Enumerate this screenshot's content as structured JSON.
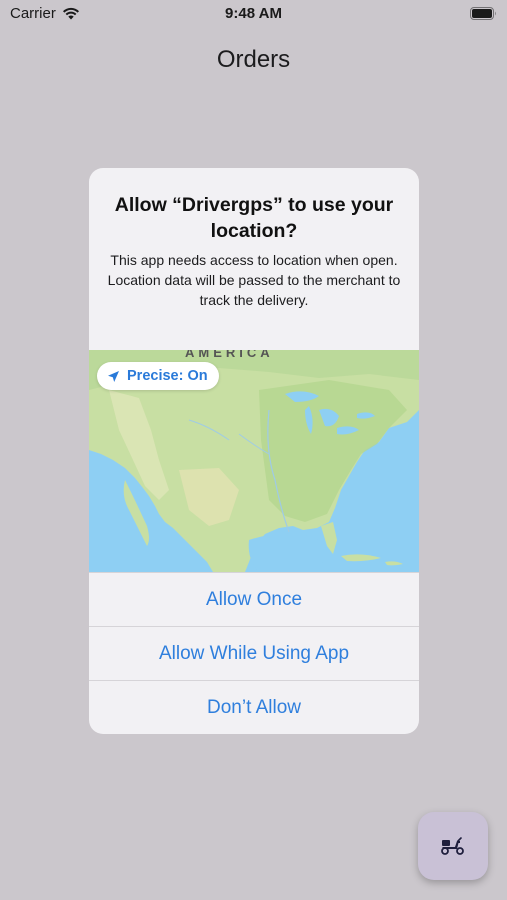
{
  "status_bar": {
    "carrier": "Carrier",
    "time": "9:48 AM",
    "wifi_icon": "wifi-icon",
    "battery_icon": "battery-icon"
  },
  "nav": {
    "title": "Orders"
  },
  "alert": {
    "title": "Allow “Drivergps” to use your location?",
    "message": "This app needs access to location when open. Location data will be passed to the merchant to track the delivery.",
    "map_label": "AMERICA",
    "precise_label": "Precise: On",
    "precise_icon": "location-arrow-icon",
    "actions": [
      {
        "label": "Allow Once"
      },
      {
        "label": "Allow While Using App"
      },
      {
        "label": "Don’t Allow"
      }
    ]
  },
  "fab": {
    "icon": "scooter-icon"
  },
  "colors": {
    "background": "#cbc7cc",
    "alert_background": "#f2f1f4",
    "action_blue": "#2f7fdd",
    "ocean": "#8ecff3",
    "land": "#c8dfa3",
    "fab_background": "#c9c1d6",
    "fab_icon": "#1f1f3d"
  }
}
